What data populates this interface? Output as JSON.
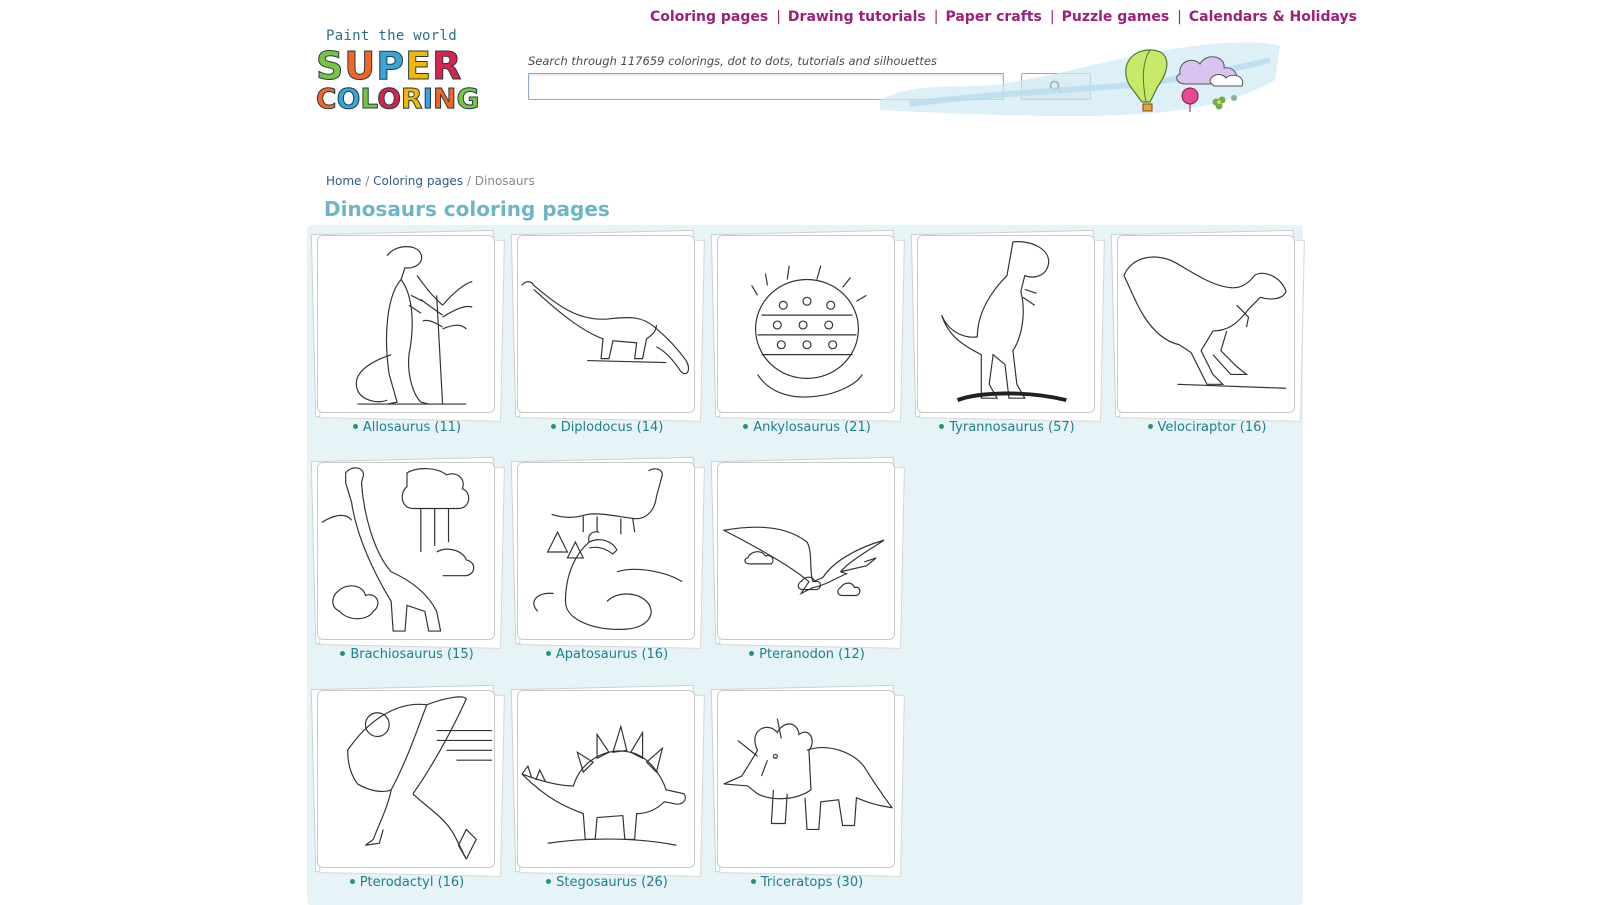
{
  "topnav": {
    "items": [
      {
        "label": "Coloring pages"
      },
      {
        "label": "Drawing tutorials"
      },
      {
        "label": "Paper crafts"
      },
      {
        "label": "Puzzle games"
      },
      {
        "label": "Calendars & Holidays"
      }
    ],
    "separator": "|"
  },
  "logo": {
    "tagline": "Paint the world",
    "word1": "SUPER",
    "word2": "COLORING",
    "word1_colors": [
      "#7cc343",
      "#f26522",
      "#3aa4d6",
      "#f5b800",
      "#d9234b"
    ],
    "word2_colors": [
      "#f26522",
      "#3aa4d6",
      "#7cc343",
      "#d9234b",
      "#f5b800",
      "#3aa4d6",
      "#f26522",
      "#7cc343"
    ]
  },
  "search": {
    "hint": "Search through 117659 colorings, dot to dots, tutorials and silhouettes",
    "placeholder": "",
    "button_icon": "magnifier-icon"
  },
  "breadcrumb": {
    "home": "Home",
    "sep": "/",
    "section": "Coloring pages",
    "current": "Dinosaurs"
  },
  "page_title": "Dinosaurs coloring pages",
  "colors": {
    "nav_link": "#9c1f7b",
    "title": "#6cb6c8",
    "caption": "#1f7f8e",
    "panel_bg": "#e6f3f7"
  },
  "cards": [
    {
      "label": "Allosaurus (11)",
      "icon": "allosaurus-drawing"
    },
    {
      "label": "Diplodocus (14)",
      "icon": "diplodocus-drawing"
    },
    {
      "label": "Ankylosaurus (21)",
      "icon": "ankylosaurus-drawing"
    },
    {
      "label": "Tyrannosaurus (57)",
      "icon": "tyrannosaurus-drawing"
    },
    {
      "label": "Velociraptor (16)",
      "icon": "velociraptor-drawing"
    },
    {
      "label": "Brachiosaurus (15)",
      "icon": "brachiosaurus-drawing"
    },
    {
      "label": "Apatosaurus (16)",
      "icon": "apatosaurus-drawing"
    },
    {
      "label": "Pteranodon (12)",
      "icon": "pteranodon-drawing"
    },
    {
      "label": "Pterodactyl (16)",
      "icon": "pterodactyl-drawing"
    },
    {
      "label": "Stegosaurus (26)",
      "icon": "stegosaurus-drawing"
    },
    {
      "label": "Triceratops (30)",
      "icon": "triceratops-drawing"
    }
  ]
}
